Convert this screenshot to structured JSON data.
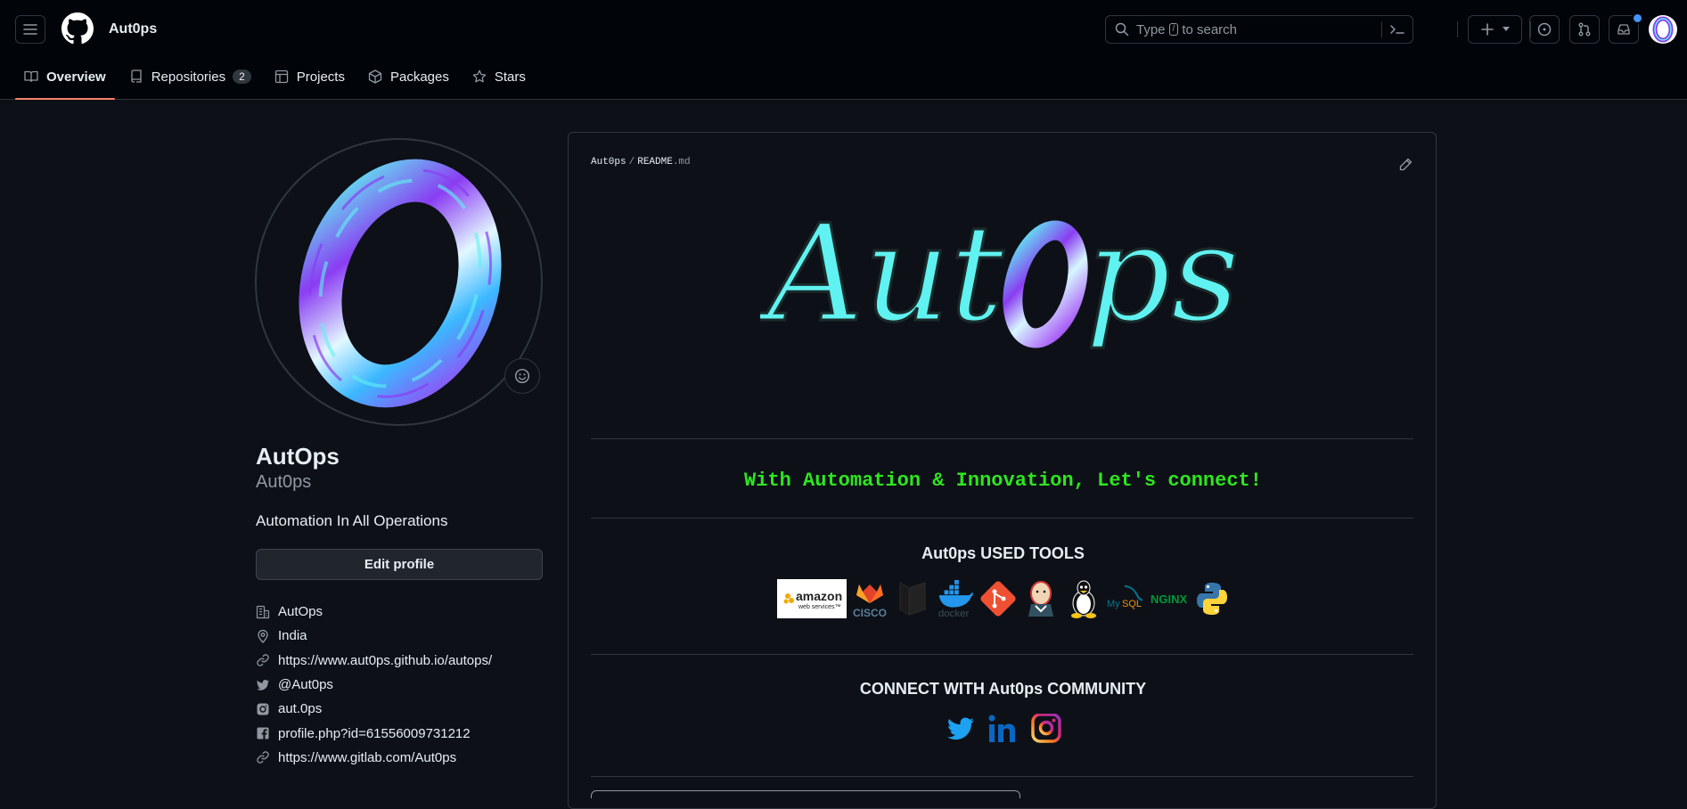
{
  "header": {
    "context_title": "Aut0ps",
    "search_type": "Type",
    "search_key": "/",
    "search_rest": "to search"
  },
  "tabs": [
    {
      "label": "Overview"
    },
    {
      "label": "Repositories",
      "count": "2"
    },
    {
      "label": "Projects"
    },
    {
      "label": "Packages"
    },
    {
      "label": "Stars"
    }
  ],
  "profile": {
    "name": "AutOps",
    "login": "Aut0ps",
    "bio": "Automation In All Operations",
    "edit_label": "Edit profile",
    "details": [
      {
        "icon": "organization-icon",
        "text": "AutOps"
      },
      {
        "icon": "location-icon",
        "text": "India"
      },
      {
        "icon": "link-icon",
        "text": "https://www.aut0ps.github.io/autops/"
      },
      {
        "icon": "twitter-icon",
        "text": "@Aut0ps"
      },
      {
        "icon": "instagram-icon",
        "text": "aut.0ps"
      },
      {
        "icon": "facebook-icon",
        "text": "profile.php?id=61556009731212"
      },
      {
        "icon": "link-icon",
        "text": "https://www.gitlab.com/Aut0ps"
      }
    ]
  },
  "readme": {
    "owner": "Aut0ps",
    "separator": "/",
    "file_name": "README",
    "file_ext": ".md",
    "banner_text": "AutOps",
    "tagline": "With Automation & Innovation, Let's connect!",
    "tools_title": "Aut0ps USED TOOLS",
    "tools": [
      {
        "icon": "aws-icon",
        "label": "amazon"
      },
      {
        "icon": "cisco-icon",
        "label": "CISCO"
      },
      {
        "icon": "gitlab-icon"
      },
      {
        "icon": "docker-icon",
        "label": "docker"
      },
      {
        "icon": "git-icon"
      },
      {
        "icon": "jenkins-icon"
      },
      {
        "icon": "linux-icon"
      },
      {
        "icon": "mysql-icon",
        "label": "MySQL"
      },
      {
        "icon": "nginx-icon",
        "label": "NGINX"
      },
      {
        "icon": "python-icon"
      }
    ],
    "community_title": "CONNECT WITH Aut0ps COMMUNITY",
    "social": [
      {
        "icon": "twitter-icon"
      },
      {
        "icon": "linkedin-icon"
      },
      {
        "icon": "instagram-icon"
      }
    ]
  },
  "colors": {
    "bg": "#0d1117",
    "header_bg": "#010409",
    "accent_tab": "#f78166",
    "tagline": "#2ee61f",
    "banner_cyan": "#5ff2f0",
    "ring_purple": "#8a3df2"
  }
}
